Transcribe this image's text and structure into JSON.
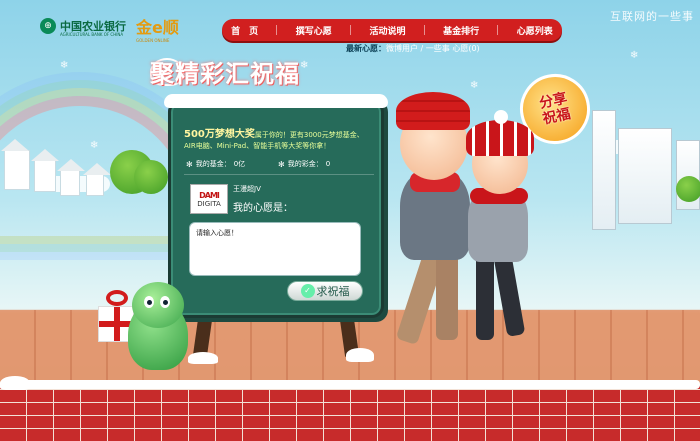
{
  "header": {
    "bank_logo_cn": "中国农业银行",
    "bank_logo_en": "AGRICULTURAL BANK OF CHINA",
    "gold_logo": "金e顺",
    "gold_logo_en": "GOLDEN ONLINE",
    "watermark": "互联网的一些事"
  },
  "nav": {
    "items": [
      {
        "label": "首　页"
      },
      {
        "label": "撰写心愿"
      },
      {
        "label": "活动说明"
      },
      {
        "label": "基金排行"
      },
      {
        "label": "心愿列表"
      }
    ]
  },
  "ticker": {
    "label": "最新心愿：",
    "text": "微博用户 / 一些事 心愿(0)"
  },
  "page_title": "聚精彩汇祝福",
  "board": {
    "prize_highlight": "500万梦想大奖",
    "prize_text": "属于你的！更有3000元梦想基金、AIR电脑、Mini-Pad、智能手机等大奖等你拿！",
    "my_fund_label": "我的基金：",
    "my_fund_value": "0亿",
    "my_colorfund_label": "我的彩金：",
    "my_colorfund_value": "0",
    "avatar_line1": "DAMI",
    "avatar_line2": "DIGITA",
    "user_name": "王漫超JV",
    "wish_label": "我的心愿是：",
    "wish_placeholder": "请输入心愿！",
    "submit_label": "求祝福"
  },
  "share": {
    "line1": "分享",
    "line2": "祝福"
  },
  "colors": {
    "nav_red": "#d11f1f",
    "board_green": "#266b5a",
    "share_orange": "#f59d16"
  }
}
